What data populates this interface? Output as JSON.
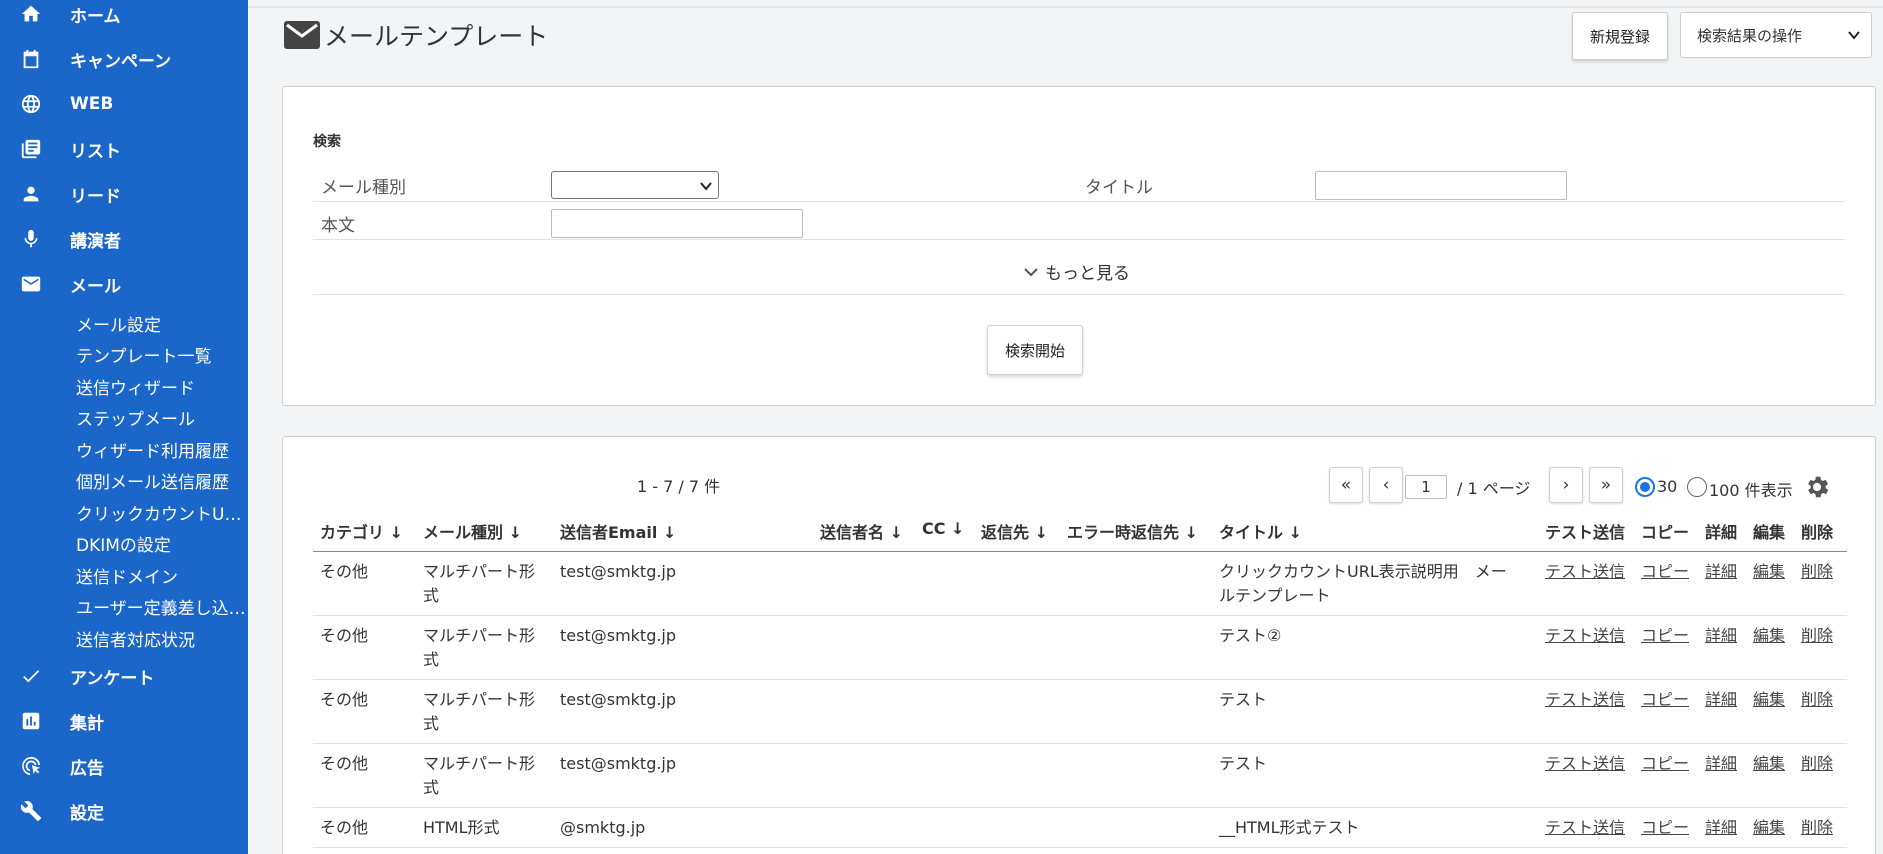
{
  "sidebar": {
    "items": [
      {
        "label": "ホーム",
        "icon": "home-icon"
      },
      {
        "label": "キャンペーン",
        "icon": "calendar-icon"
      },
      {
        "label": "WEB",
        "icon": "globe-icon"
      },
      {
        "label": "リスト",
        "icon": "list-icon"
      },
      {
        "label": "リード",
        "icon": "person-icon"
      },
      {
        "label": "講演者",
        "icon": "mic-icon"
      },
      {
        "label": "メール",
        "icon": "mail-icon"
      },
      {
        "label": "アンケート",
        "icon": "check-icon"
      },
      {
        "label": "集計",
        "icon": "chart-icon"
      },
      {
        "label": "広告",
        "icon": "target-icon"
      },
      {
        "label": "設定",
        "icon": "wrench-icon"
      }
    ],
    "mail_sub": [
      "メール設定",
      "テンプレート一覧",
      "送信ウィザード",
      "ステップメール",
      "ウィザード利用履歴",
      "個別メール送信履歴",
      "クリックカウントU…",
      "DKIMの設定",
      "送信ドメイン",
      "ユーザー定義差し込…",
      "送信者対応状況"
    ]
  },
  "header": {
    "title": "メールテンプレート",
    "new_button": "新規登録",
    "ops_select": "検索結果の操作"
  },
  "search": {
    "heading": "検索",
    "mail_type_label": "メール種別",
    "mail_type_value": "",
    "title_label": "タイトル",
    "title_value": "",
    "body_label": "本文",
    "body_value": "",
    "more": "もっと見る",
    "start_button": "検索開始"
  },
  "list": {
    "count": "1 - 7 / 7 件",
    "first": "«",
    "prev": "‹",
    "page": "1",
    "page_total": "/ 1 ページ",
    "next": "›",
    "last": "»",
    "per_page_30": "30",
    "per_page_100": "100 件表示",
    "per_page_selected": "30",
    "columns": [
      "カテゴリ ↓",
      "メール種別 ↓",
      "送信者Email ↓",
      "送信者名 ↓",
      "CC ↓",
      "返信先 ↓",
      "エラー時返信先 ↓",
      "タイトル ↓",
      "テスト送信",
      "コピー",
      "詳細",
      "編集",
      "削除"
    ],
    "actions": [
      "テスト送信",
      "コピー",
      "詳細",
      "編集",
      "削除"
    ],
    "rows": [
      {
        "category": "その他",
        "type_l1": "マルチパート形",
        "type_l2": "式",
        "email": "test@smktg.jp",
        "title_l1": "クリックカウントURL表示説明用　メー",
        "title_l2": "ルテンプレート"
      },
      {
        "category": "その他",
        "type_l1": "マルチパート形",
        "type_l2": "式",
        "email": "test@smktg.jp",
        "title_l1": "テスト②",
        "title_l2": ""
      },
      {
        "category": "その他",
        "type_l1": "マルチパート形",
        "type_l2": "式",
        "email": "test@smktg.jp",
        "title_l1": "テスト",
        "title_l2": ""
      },
      {
        "category": "その他",
        "type_l1": "マルチパート形",
        "type_l2": "式",
        "email": "test@smktg.jp",
        "title_l1": "テスト",
        "title_l2": ""
      },
      {
        "category": "その他",
        "type_l1": "HTML形式",
        "type_l2": "",
        "email": "@smktg.jp",
        "title_l1": "__HTML形式テスト",
        "title_l2": ""
      }
    ]
  },
  "colors": {
    "sidebar_bg": "#1b66c9",
    "radio_accent": "#1a73e8"
  }
}
